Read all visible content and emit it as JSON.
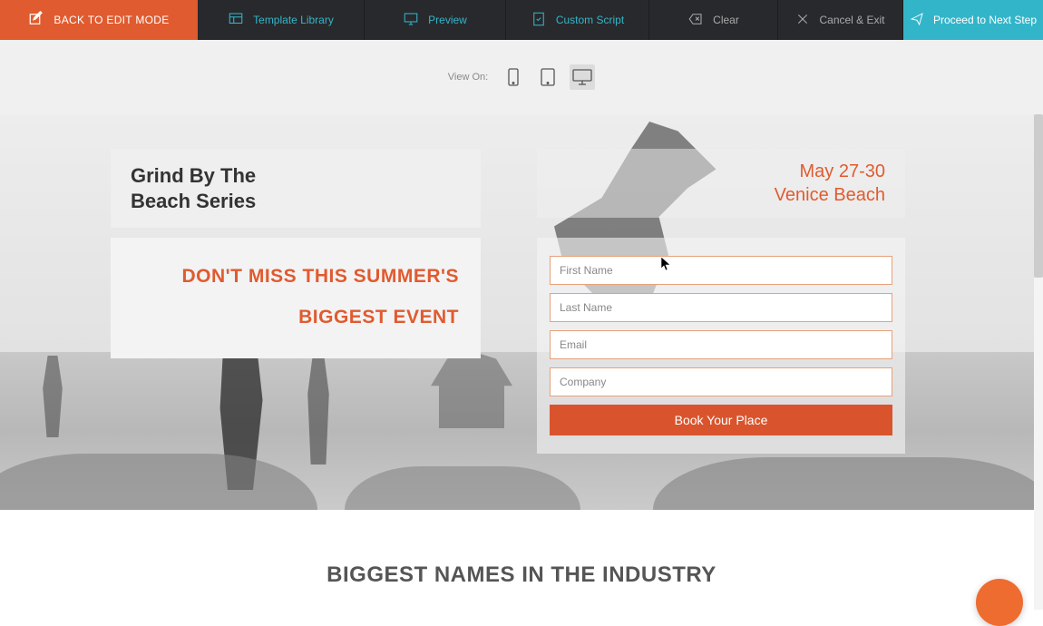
{
  "toolbar": {
    "back_label": "BACK TO EDIT MODE",
    "template_library_label": "Template Library",
    "preview_label": "Preview",
    "custom_script_label": "Custom Script",
    "clear_label": "Clear",
    "cancel_exit_label": "Cancel & Exit",
    "proceed_label": "Proceed to Next Step"
  },
  "view_on": {
    "label": "View On:"
  },
  "hero": {
    "title": "Grind By The\nBeach Series",
    "date": "May 27-30",
    "location": "Venice Beach",
    "subtitle_line1": "DON'T MISS THIS SUMMER'S",
    "subtitle_line2": "BIGGEST EVENT"
  },
  "form": {
    "first_name_placeholder": "First Name",
    "last_name_placeholder": "Last Name",
    "email_placeholder": "Email",
    "company_placeholder": "Company",
    "submit_label": "Book Your Place"
  },
  "section": {
    "industry_heading": "BIGGEST NAMES IN THE INDUSTRY"
  }
}
